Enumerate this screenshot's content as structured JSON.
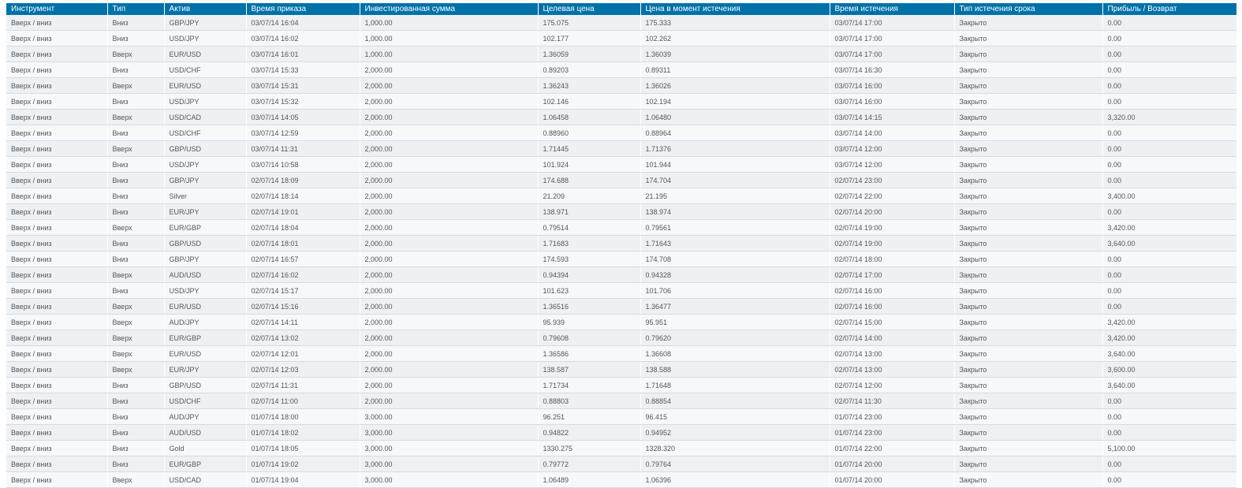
{
  "table": {
    "columns": [
      "Инструмент",
      "Тип",
      "Актив",
      "Время приказа",
      "Инвестированная сумма",
      "Целевая цена",
      "Цена в момент истечения",
      "Время истечения",
      "Тип истечения срока",
      "Прибыль / Возврат"
    ],
    "rows": [
      [
        "Вверх / вниз",
        "Вниз",
        "GBP/JPY",
        "03/07/14 16:04",
        "1,000.00",
        "175.075",
        "175.333",
        "03/07/14 17:00",
        "Закрыто",
        "0.00"
      ],
      [
        "Вверх / вниз",
        "Вниз",
        "USD/JPY",
        "03/07/14 16:02",
        "1,000.00",
        "102.177",
        "102.262",
        "03/07/14 17:00",
        "Закрыто",
        "0.00"
      ],
      [
        "Вверх / вниз",
        "Вверх",
        "EUR/USD",
        "03/07/14 16:01",
        "1,000.00",
        "1.36059",
        "1.36039",
        "03/07/14 17:00",
        "Закрыто",
        "0.00"
      ],
      [
        "Вверх / вниз",
        "Вниз",
        "USD/CHF",
        "03/07/14 15:33",
        "2,000.00",
        "0.89203",
        "0.89311",
        "03/07/14 16:30",
        "Закрыто",
        "0.00"
      ],
      [
        "Вверх / вниз",
        "Вверх",
        "EUR/USD",
        "03/07/14 15:31",
        "2,000.00",
        "1.36243",
        "1.36026",
        "03/07/14 16:00",
        "Закрыто",
        "0.00"
      ],
      [
        "Вверх / вниз",
        "Вниз",
        "USD/JPY",
        "03/07/14 15:32",
        "2,000.00",
        "102.146",
        "102.194",
        "03/07/14 16:00",
        "Закрыто",
        "0.00"
      ],
      [
        "Вверх / вниз",
        "Вверх",
        "USD/CAD",
        "03/07/14 14:05",
        "2,000.00",
        "1.06458",
        "1.06480",
        "03/07/14 14:15",
        "Закрыто",
        "3,320.00"
      ],
      [
        "Вверх / вниз",
        "Вниз",
        "USD/CHF",
        "03/07/14 12:59",
        "2,000.00",
        "0.88960",
        "0.88964",
        "03/07/14 14:00",
        "Закрыто",
        "0.00"
      ],
      [
        "Вверх / вниз",
        "Вверх",
        "GBP/USD",
        "03/07/14 11:31",
        "2,000.00",
        "1.71445",
        "1.71376",
        "03/07/14 12:00",
        "Закрыто",
        "0.00"
      ],
      [
        "Вверх / вниз",
        "Вниз",
        "USD/JPY",
        "03/07/14 10:58",
        "2,000.00",
        "101.924",
        "101.944",
        "03/07/14 12:00",
        "Закрыто",
        "0.00"
      ],
      [
        "Вверх / вниз",
        "Вниз",
        "GBP/JPY",
        "02/07/14 18:09",
        "2,000.00",
        "174.688",
        "174.704",
        "02/07/14 23:00",
        "Закрыто",
        "0.00"
      ],
      [
        "Вверх / вниз",
        "Вниз",
        "Silver",
        "02/07/14 18:14",
        "2,000.00",
        "21.209",
        "21.195",
        "02/07/14 22:00",
        "Закрыто",
        "3,400.00"
      ],
      [
        "Вверх / вниз",
        "Вниз",
        "EUR/JPY",
        "02/07/14 19:01",
        "2,000.00",
        "138.971",
        "138.974",
        "02/07/14 20:00",
        "Закрыто",
        "0.00"
      ],
      [
        "Вверх / вниз",
        "Вверх",
        "EUR/GBP",
        "02/07/14 18:04",
        "2,000.00",
        "0.79514",
        "0.79561",
        "02/07/14 19:00",
        "Закрыто",
        "3,420.00"
      ],
      [
        "Вверх / вниз",
        "Вниз",
        "GBP/USD",
        "02/07/14 18:01",
        "2,000.00",
        "1.71683",
        "1.71643",
        "02/07/14 19:00",
        "Закрыто",
        "3,640.00"
      ],
      [
        "Вверх / вниз",
        "Вниз",
        "GBP/JPY",
        "02/07/14 16:57",
        "2,000.00",
        "174.593",
        "174.708",
        "02/07/14 18:00",
        "Закрыто",
        "0.00"
      ],
      [
        "Вверх / вниз",
        "Вверх",
        "AUD/USD",
        "02/07/14 16:02",
        "2,000.00",
        "0.94394",
        "0.94328",
        "02/07/14 17:00",
        "Закрыто",
        "0.00"
      ],
      [
        "Вверх / вниз",
        "Вниз",
        "USD/JPY",
        "02/07/14 15:17",
        "2,000.00",
        "101.623",
        "101.706",
        "02/07/14 16:00",
        "Закрыто",
        "0.00"
      ],
      [
        "Вверх / вниз",
        "Вверх",
        "EUR/USD",
        "02/07/14 15:16",
        "2,000.00",
        "1.36516",
        "1.36477",
        "02/07/14 16:00",
        "Закрыто",
        "0.00"
      ],
      [
        "Вверх / вниз",
        "Вверх",
        "AUD/JPY",
        "02/07/14 14:11",
        "2,000.00",
        "95.939",
        "95.951",
        "02/07/14 15:00",
        "Закрыто",
        "3,420.00"
      ],
      [
        "Вверх / вниз",
        "Вверх",
        "EUR/GBP",
        "02/07/14 13:02",
        "2,000.00",
        "0.79608",
        "0.79620",
        "02/07/14 14:00",
        "Закрыто",
        "3,420.00"
      ],
      [
        "Вверх / вниз",
        "Вверх",
        "EUR/USD",
        "02/07/14 12:01",
        "2,000.00",
        "1.36586",
        "1.36608",
        "02/07/14 13:00",
        "Закрыто",
        "3,640.00"
      ],
      [
        "Вверх / вниз",
        "Вверх",
        "EUR/JPY",
        "02/07/14 12:03",
        "2,000.00",
        "138.587",
        "138.588",
        "02/07/14 13:00",
        "Закрыто",
        "3,600.00"
      ],
      [
        "Вверх / вниз",
        "Вниз",
        "GBP/USD",
        "02/07/14 11:31",
        "2,000.00",
        "1.71734",
        "1.71648",
        "02/07/14 12:00",
        "Закрыто",
        "3,640.00"
      ],
      [
        "Вверх / вниз",
        "Вниз",
        "USD/CHF",
        "02/07/14 11:00",
        "2,000.00",
        "0.88803",
        "0.88854",
        "02/07/14 11:30",
        "Закрыто",
        "0.00"
      ],
      [
        "Вверх / вниз",
        "Вниз",
        "AUD/JPY",
        "01/07/14 18:00",
        "3,000.00",
        "96.251",
        "96.415",
        "01/07/14 23:00",
        "Закрыто",
        "0.00"
      ],
      [
        "Вверх / вниз",
        "Вниз",
        "AUD/USD",
        "01/07/14 18:02",
        "3,000.00",
        "0.94822",
        "0.94952",
        "01/07/14 23:00",
        "Закрыто",
        "0.00"
      ],
      [
        "Вверх / вниз",
        "Вниз",
        "Gold",
        "01/07/14 18:05",
        "3,000.00",
        "1330.275",
        "1328.320",
        "01/07/14 22:00",
        "Закрыто",
        "5,100.00"
      ],
      [
        "Вверх / вниз",
        "Вниз",
        "EUR/GBP",
        "01/07/14 19:02",
        "3,000.00",
        "0.79772",
        "0.79764",
        "01/07/14 20:00",
        "Закрыто",
        "0.00"
      ],
      [
        "Вверх / вниз",
        "Вверх",
        "USD/CAD",
        "01/07/14 19:04",
        "3,000.00",
        "1.06489",
        "1.06396",
        "01/07/14 20:00",
        "Закрыто",
        "0.00"
      ]
    ]
  }
}
